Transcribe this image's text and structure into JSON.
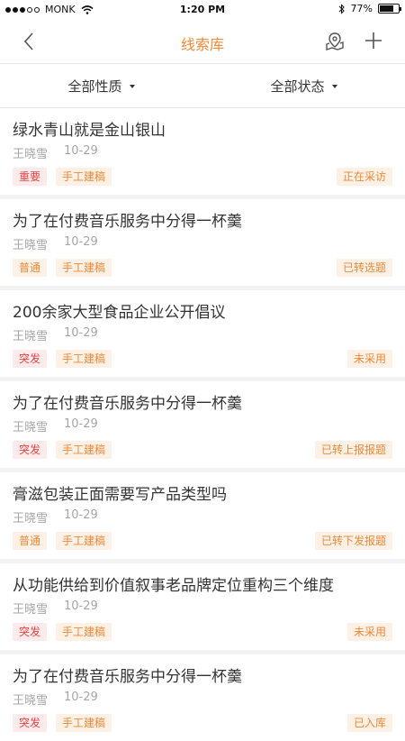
{
  "status_bar": {
    "carrier": "MONK",
    "time": "1:20 PM",
    "battery": "77%",
    "battery_level": 0.77
  },
  "nav": {
    "title": "线索库",
    "back_icon": "chevron-left-icon",
    "map_icon": "map-pin-icon",
    "add_icon": "plus-icon"
  },
  "filters": {
    "nature": "全部性质",
    "status": "全部状态"
  },
  "colors": {
    "accent": "#f08a3a",
    "tag_red_bg": "#fdeaea",
    "tag_red_text": "#e04545",
    "tag_orange_bg": "#fdf0e4",
    "tag_orange_text": "#e88a3a"
  },
  "items": [
    {
      "title": "绿水青山就是金山银山",
      "author": "王晓雪",
      "date": "10-29",
      "priority": "重要",
      "type": "手工建稿",
      "status": "正在采访"
    },
    {
      "title": "为了在付费音乐服务中分得一杯羹",
      "author": "王晓雪",
      "date": "10-29",
      "priority": "普通",
      "type": "手工建稿",
      "status": "已转选题"
    },
    {
      "title": "200余家大型食品企业公开倡议",
      "author": "王晓雪",
      "date": "10-29",
      "priority": "突发",
      "type": "手工建稿",
      "status": "未采用"
    },
    {
      "title": "为了在付费音乐服务中分得一杯羹",
      "author": "王晓雪",
      "date": "10-29",
      "priority": "突发",
      "type": "手工建稿",
      "status": "已转上报报题"
    },
    {
      "title": "膏滋包装正面需要写产品类型吗",
      "author": "王晓雪",
      "date": "10-29",
      "priority": "普通",
      "type": "手工建稿",
      "status": "已转下发报题"
    },
    {
      "title": "从功能供给到价值叙事老品牌定位重构三个维度",
      "author": "王晓雪",
      "date": "10-29",
      "priority": "突发",
      "type": "手工建稿",
      "status": "未采用"
    },
    {
      "title": "为了在付费音乐服务中分得一杯羹",
      "author": "王晓雪",
      "date": "10-29",
      "priority": "突发",
      "type": "手工建稿",
      "status": "已入库"
    }
  ]
}
